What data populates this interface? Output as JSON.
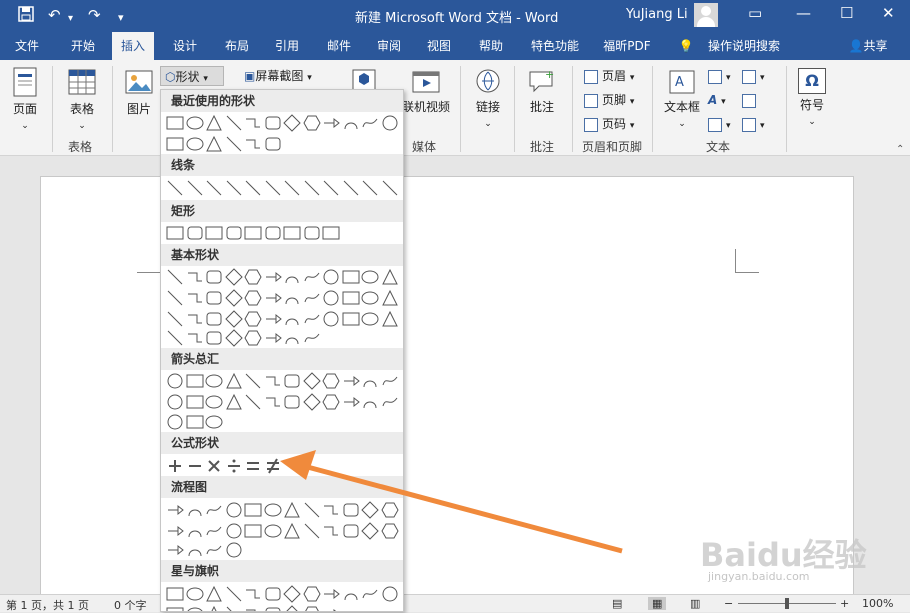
{
  "titlebar": {
    "doc_title": "新建 Microsoft Word 文档  -  Word",
    "user": "YuJiang Li",
    "save_icon": "save-icon",
    "undo_icon": "undo-icon",
    "redo_icon": "redo-icon",
    "bg": "#2b579a"
  },
  "tabs": [
    "文件",
    "开始",
    "插入",
    "设计",
    "布局",
    "引用",
    "邮件",
    "审阅",
    "视图",
    "帮助",
    "特色功能",
    "福昕PDF",
    "操作说明搜索",
    "共享"
  ],
  "ribbon": {
    "page_btn": "页面",
    "table_btn": "表格",
    "table_group": "表格",
    "picture_btn": "图片",
    "shapes_btn": "形状",
    "screenshot_btn": "屏幕截图",
    "online_video_btn": "联机视频",
    "media_group": "媒体",
    "link_btn": "链接",
    "comment_btn": "批注",
    "comment_group": "批注",
    "header_btn": "页眉",
    "footer_btn": "页脚",
    "pagenum_btn": "页码",
    "header_group": "页眉和页脚",
    "textbox_btn": "文本框",
    "text_group": "文本",
    "symbol_btn": "符号"
  },
  "dropdown": {
    "sections": [
      "最近使用的形状",
      "线条",
      "矩形",
      "基本形状",
      "箭头总汇",
      "公式形状",
      "流程图",
      "星与旗帜"
    ]
  },
  "statusbar": {
    "page_info": "第 1 页，共 1 页",
    "word_count": "0 个字",
    "zoom": "100%"
  },
  "watermark": {
    "text": "Baidu经验",
    "sub": "jingyan.baidu.com"
  },
  "arrow_color": "#f08a3c"
}
